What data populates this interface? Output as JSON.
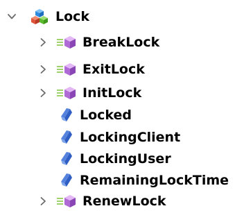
{
  "tree": {
    "root": {
      "label": "Lock",
      "icon": "class-icon",
      "expanded": true
    },
    "children": [
      {
        "label": "BreakLock",
        "icon": "method-icon",
        "expandable": true
      },
      {
        "label": "ExitLock",
        "icon": "method-icon",
        "expandable": true
      },
      {
        "label": "InitLock",
        "icon": "method-icon",
        "expandable": true
      },
      {
        "label": "Locked",
        "icon": "property-icon",
        "expandable": false
      },
      {
        "label": "LockingClient",
        "icon": "property-icon",
        "expandable": false
      },
      {
        "label": "LockingUser",
        "icon": "property-icon",
        "expandable": false
      },
      {
        "label": "RemainingLockTime",
        "icon": "property-icon",
        "expandable": false
      },
      {
        "label": "RenewLock",
        "icon": "method-icon",
        "expandable": true
      }
    ]
  },
  "colors": {
    "chevron": "#6b6b6b",
    "method_purple": "#b06ad6",
    "method_lines": "#9fd36a",
    "property_blue": "#2f5fc4",
    "class_red": "#e0543a",
    "class_green": "#5cb82e",
    "class_blue": "#2d8ce0"
  }
}
